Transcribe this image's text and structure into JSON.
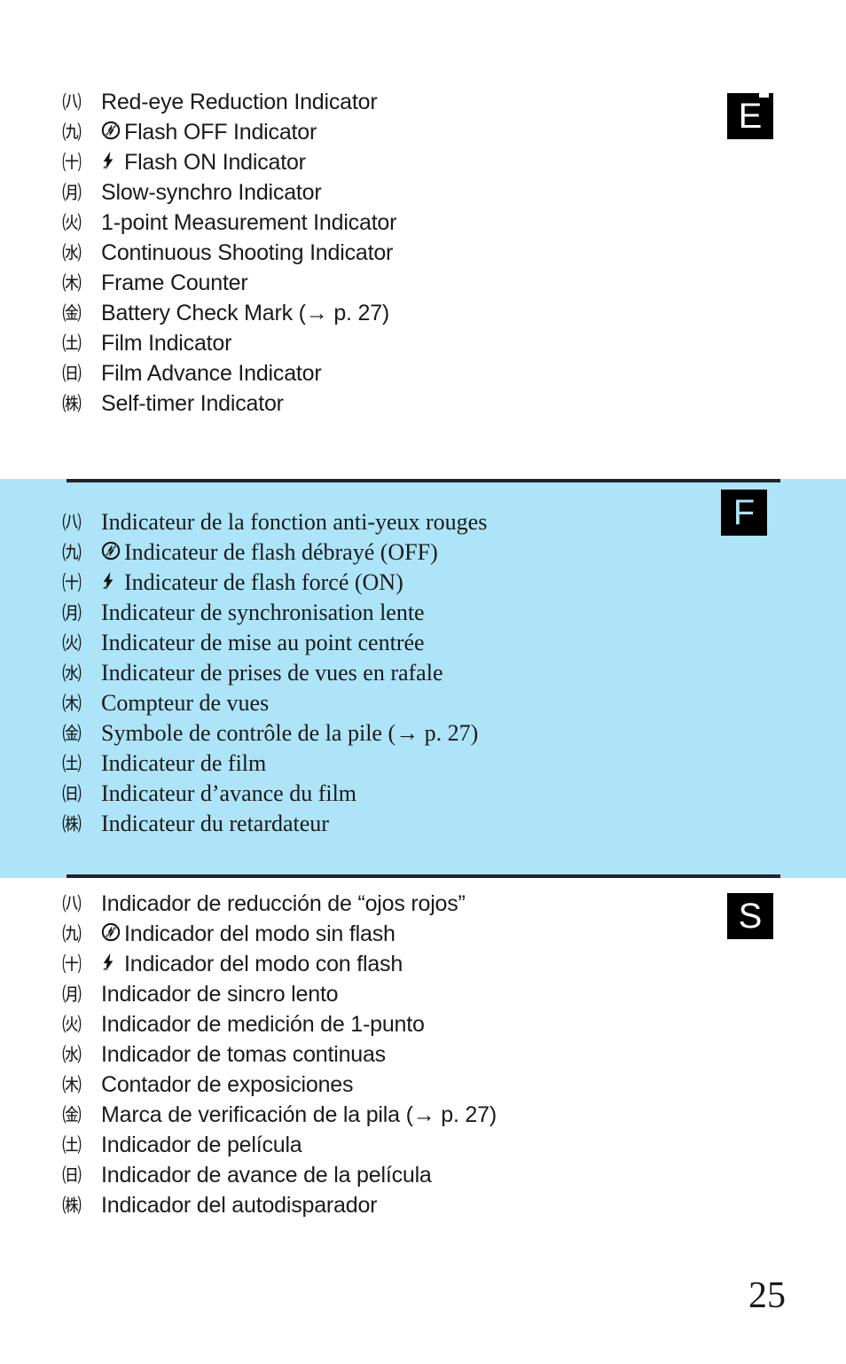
{
  "page": {
    "number": "25",
    "accent_blue": "#ade4f8",
    "tab_blue": "#c6ebfa",
    "rule_color": "#20242b"
  },
  "edge_tab": {
    "name": "thumb-index-tab"
  },
  "sections": [
    {
      "id": "en",
      "badge": "E",
      "badge_name": "language-badge-english",
      "items": [
        {
          "num": "㈧",
          "glyph": "",
          "label": "Red-eye Reduction Indicator"
        },
        {
          "num": "㈨",
          "glyph": "flash-off-icon",
          "label": "Flash OFF Indicator"
        },
        {
          "num": "㈩",
          "glyph": "flash-on-icon",
          "label": "Flash ON Indicator"
        },
        {
          "num": "㈪",
          "glyph": "",
          "label": "Slow-synchro Indicator"
        },
        {
          "num": "㈫",
          "glyph": "",
          "label": "1-point Measurement Indicator"
        },
        {
          "num": "㈬",
          "glyph": "",
          "label": "Continuous Shooting Indicator"
        },
        {
          "num": "㈭",
          "glyph": "",
          "label": "Frame Counter"
        },
        {
          "num": "㈮",
          "glyph": "",
          "label": "Battery Check Mark (→ p. 27)"
        },
        {
          "num": "㈯",
          "glyph": "",
          "label": "Film Indicator"
        },
        {
          "num": "㈰",
          "glyph": "",
          "label": "Film Advance Indicator"
        },
        {
          "num": "㈱",
          "glyph": "",
          "label": "Self-timer Indicator"
        }
      ]
    },
    {
      "id": "fr",
      "badge": "F",
      "badge_name": "language-badge-french",
      "items": [
        {
          "num": "㈧",
          "glyph": "",
          "label": "Indicateur de la fonction anti-yeux rouges"
        },
        {
          "num": "㈨",
          "glyph": "flash-off-icon",
          "label": "Indicateur de flash débrayé (OFF)"
        },
        {
          "num": "㈩",
          "glyph": "flash-on-icon",
          "label": "Indicateur de flash forcé (ON)"
        },
        {
          "num": "㈪",
          "glyph": "",
          "label": "Indicateur de synchronisation lente"
        },
        {
          "num": "㈫",
          "glyph": "",
          "label": "Indicateur de mise au point centrée"
        },
        {
          "num": "㈬",
          "glyph": "",
          "label": "Indicateur de prises de vues en rafale"
        },
        {
          "num": "㈭",
          "glyph": "",
          "label": "Compteur de vues"
        },
        {
          "num": "㈮",
          "glyph": "",
          "label": "Symbole de contrôle de la pile (→ p. 27)"
        },
        {
          "num": "㈯",
          "glyph": "",
          "label": "Indicateur de film"
        },
        {
          "num": "㈰",
          "glyph": "",
          "label": "Indicateur d’avance du film"
        },
        {
          "num": "㈱",
          "glyph": "",
          "label": "Indicateur du retardateur"
        }
      ]
    },
    {
      "id": "es",
      "badge": "S",
      "badge_name": "language-badge-spanish",
      "items": [
        {
          "num": "㈧",
          "glyph": "",
          "label": "Indicador de reducción de “ojos rojos”"
        },
        {
          "num": "㈨",
          "glyph": "flash-off-icon",
          "label": "Indicador del modo sin flash"
        },
        {
          "num": "㈩",
          "glyph": "flash-on-icon",
          "label": "Indicador del modo con flash"
        },
        {
          "num": "㈪",
          "glyph": "",
          "label": "Indicador de sincro lento"
        },
        {
          "num": "㈫",
          "glyph": "",
          "label": "Indicador de medición de 1-punto"
        },
        {
          "num": "㈬",
          "glyph": "",
          "label": "Indicador de tomas continuas"
        },
        {
          "num": "㈭",
          "glyph": "",
          "label": "Contador de exposiciones"
        },
        {
          "num": "㈮",
          "glyph": "",
          "label": "Marca de verificación de la pila (→ p. 27)"
        },
        {
          "num": "㈯",
          "glyph": "",
          "label": "Indicador de película"
        },
        {
          "num": "㈰",
          "glyph": "",
          "label": "Indicador de avance de la película"
        },
        {
          "num": "㈱",
          "glyph": "",
          "label": "Indicador del autodisparador"
        }
      ]
    }
  ]
}
